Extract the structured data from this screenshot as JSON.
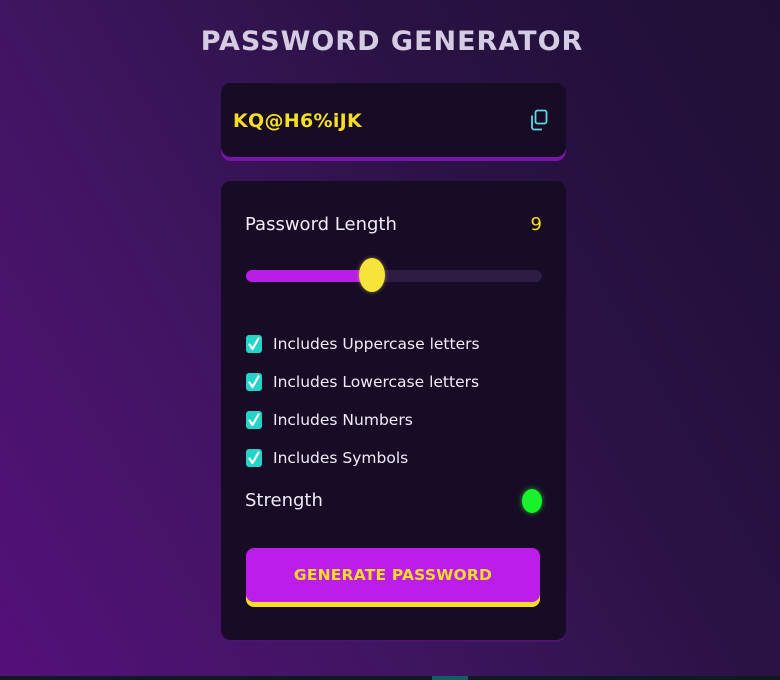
{
  "app": {
    "title": "PASSWORD GENERATOR"
  },
  "output": {
    "password": "KQ@H6%iJK",
    "copy_icon": "copy-icon"
  },
  "length": {
    "label": "Password Length",
    "value": "9",
    "slider_fill_fraction": 0.425
  },
  "options": [
    {
      "label": "Includes Uppercase letters",
      "checked": true
    },
    {
      "label": "Includes Lowercase letters",
      "checked": true
    },
    {
      "label": "Includes Numbers",
      "checked": true
    },
    {
      "label": "Includes Symbols",
      "checked": true
    }
  ],
  "strength": {
    "label": "Strength",
    "indicator_color": "#19f22a"
  },
  "generate": {
    "label": "GENERATE PASSWORD"
  },
  "colors": {
    "accent_purple": "#bd1de8",
    "accent_yellow": "#f5df24",
    "checkbox_teal": "#25d3c8",
    "card_bg": "#180b26"
  }
}
